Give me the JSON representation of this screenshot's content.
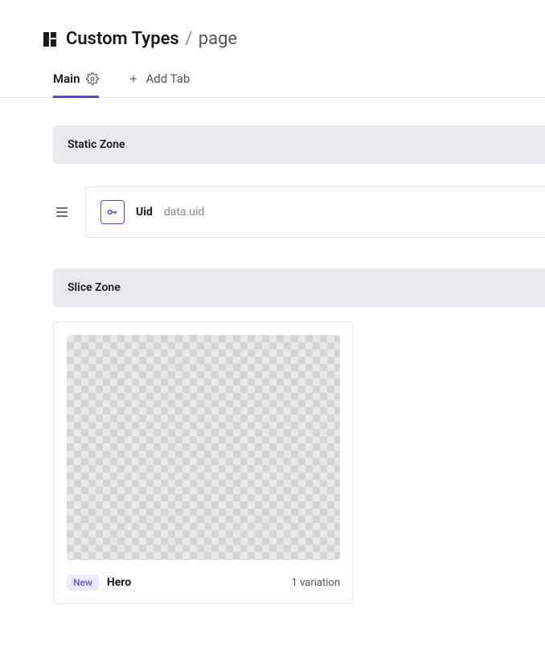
{
  "header": {
    "title": "Custom Types",
    "separator": "/",
    "subpage": "page"
  },
  "tabs": {
    "main": "Main",
    "addTab": "Add Tab"
  },
  "zones": {
    "static": "Static Zone",
    "slice": "Slice Zone"
  },
  "fields": [
    {
      "label": "Uid",
      "path": "data.uid"
    }
  ],
  "slices": [
    {
      "badge": "New",
      "name": "Hero",
      "variations": "1 variation"
    }
  ]
}
